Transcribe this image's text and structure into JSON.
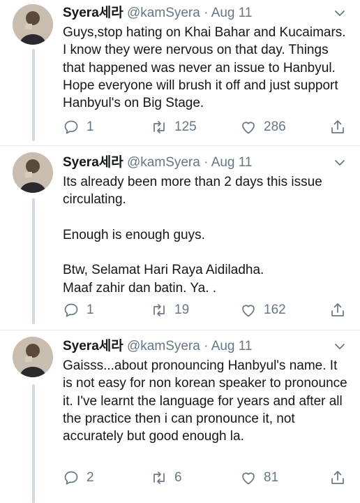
{
  "tweets": [
    {
      "author": {
        "name": "Syera세라",
        "handle": "@kamSyera",
        "separator": "·",
        "date": "Aug 11"
      },
      "text": "Guys,stop hating on Khai Bahar and Kucaimars. I know they were nervous on that day. Things that happened was never an issue to Hanbyul. Hope everyone will brush it off and just support Hanbyul's on Big Stage.",
      "reply_count": "1",
      "retweet_count": "125",
      "like_count": "286"
    },
    {
      "author": {
        "name": "Syera세라",
        "handle": "@kamSyera",
        "separator": "·",
        "date": "Aug 11"
      },
      "text": "Its already been more than 2 days this issue circulating.\n\nEnough is enough guys.\n\nBtw, Selamat Hari Raya Aidiladha.\nMaaf zahir dan batin. Ya. .",
      "reply_count": "1",
      "retweet_count": "19",
      "like_count": "162"
    },
    {
      "author": {
        "name": "Syera세라",
        "handle": "@kamSyera",
        "separator": "·",
        "date": "Aug 11"
      },
      "text": "Gaisss...about pronouncing Hanbyul's name. It is not easy for non korean speaker to pronounce it. I've learnt the language for years and after all the practice then i can pronounce it, not accurately but good enough la.",
      "reply_count": "2",
      "retweet_count": "6",
      "like_count": "81"
    }
  ],
  "icons": {
    "reply": "reply-icon",
    "retweet": "retweet-icon",
    "like": "heart-icon",
    "share": "share-icon",
    "caret": "chevron-down-icon"
  },
  "colors": {
    "text": "#14171a",
    "muted": "#657786",
    "thread_line": "#cfd9de",
    "divider": "#e6ecf0"
  }
}
